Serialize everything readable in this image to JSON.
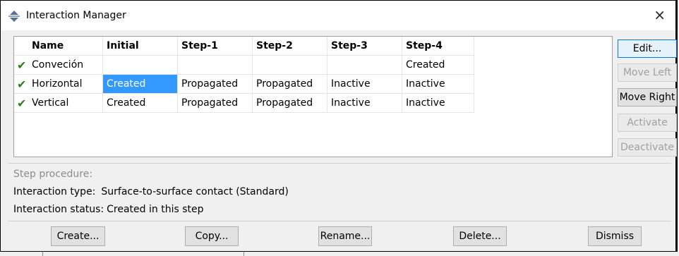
{
  "window": {
    "title": "Interaction Manager",
    "close_glyph": "×"
  },
  "table": {
    "columns": [
      "Name",
      "Initial",
      "Step-1",
      "Step-2",
      "Step-3",
      "Step-4"
    ],
    "rows": [
      {
        "check": "✔",
        "cells": [
          "Conveción",
          "",
          "",
          "",
          "",
          "Created"
        ]
      },
      {
        "check": "✔",
        "cells": [
          "Horizontal",
          "Created",
          "Propagated",
          "Propagated",
          "Inactive",
          "Inactive"
        ]
      },
      {
        "check": "✔",
        "cells": [
          "Vertical",
          "Created",
          "Propagated",
          "Propagated",
          "Inactive",
          "Inactive"
        ]
      }
    ],
    "selected_cell": {
      "row": 1,
      "col": 1
    },
    "check_color": "#2e7d1e",
    "selection_color": "#3399ff"
  },
  "side_buttons": {
    "edit": "Edit...",
    "move_left": "Move Left",
    "move_right": "Move Right",
    "activate": "Activate",
    "deactivate": "Deactivate"
  },
  "info": {
    "step_procedure_label": "Step procedure:",
    "interaction_type_label": "Interaction type:",
    "interaction_type_value": "Surface-to-surface contact (Standard)",
    "interaction_status_label": "Interaction status:",
    "interaction_status_value": "Created in this step"
  },
  "bottom_buttons": {
    "create": "Create...",
    "copy": "Copy...",
    "rename": "Rename...",
    "delete": "Delete...",
    "dismiss": "Dismiss"
  }
}
